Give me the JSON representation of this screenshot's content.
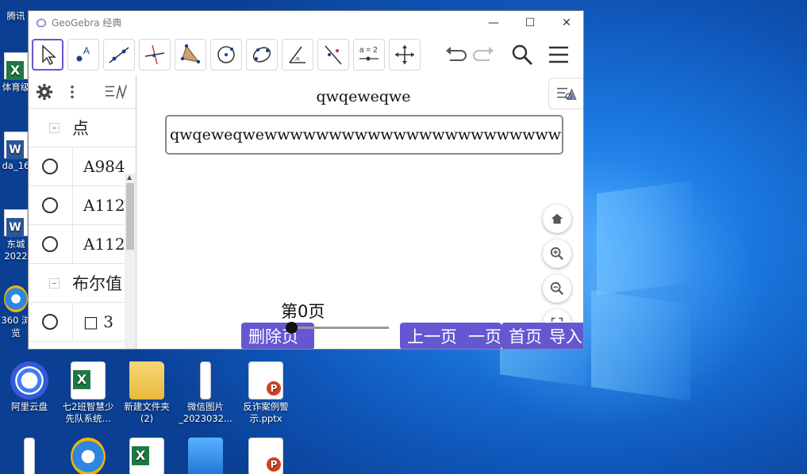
{
  "window": {
    "title": "GeoGebra 经典"
  },
  "window_controls": {
    "minimize": "—",
    "maximize": "☐",
    "close": "✕"
  },
  "toolbar": {
    "tools": [
      "move",
      "point",
      "line",
      "perpendicular",
      "polygon",
      "circle",
      "conic",
      "angle",
      "reflect",
      "slider",
      "move-graphics"
    ],
    "slider_tool_text": "a = 2"
  },
  "algebra": {
    "groups": [
      {
        "label": "点",
        "items": [
          "A₉₈₄",
          "A₁₁₂",
          "A₁₁₂"
        ]
      },
      {
        "label": "布尔值"
      }
    ],
    "items_display": [
      "A984",
      "A112",
      "A112"
    ],
    "bool_item": "□ 3"
  },
  "graphics": {
    "caption": "qwqeweqwe",
    "input_value": "qwqeweqwewwwwwwwwwwwwwwwwwwwwwwwwwwweeee",
    "page_label": "第0页",
    "buttons": {
      "delete": "删除页",
      "prev": "上一页",
      "next_partial": "一页",
      "first": "首页",
      "import_partial": "导入页"
    },
    "slider_value_fraction": 0
  },
  "desktop": {
    "icons": [
      {
        "name": "阿里云盘",
        "type": "cloud"
      },
      {
        "name": "七2班智慧少先队系统...",
        "type": "excel"
      },
      {
        "name": "新建文件夹 (2)",
        "type": "folder"
      },
      {
        "name": "微信图片_2023032...",
        "type": "file"
      },
      {
        "name": "反诈案例警示.pptx",
        "type": "ppt"
      }
    ],
    "left_labels": [
      "腾讯",
      "体育级",
      "da_16",
      "东城 2022",
      "360 浏览"
    ]
  },
  "colors": {
    "accent": "#6557d2",
    "desktop_bg": "#1565c8"
  }
}
